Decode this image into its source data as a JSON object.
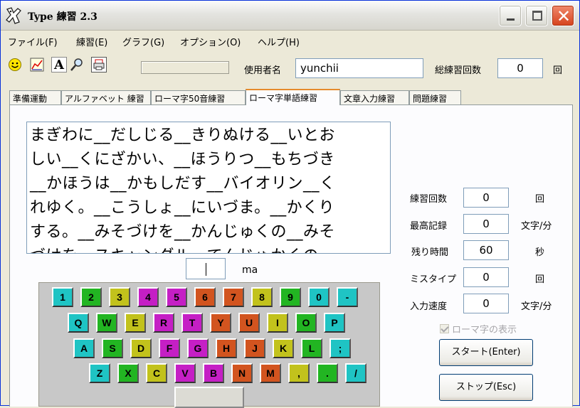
{
  "window": {
    "title": "Type 練習 2.3",
    "close_glyph": "✕"
  },
  "menu": [
    "ファイル(F)",
    "練習(E)",
    "グラフ(G)",
    "オプション(O)",
    "ヘルプ(H)"
  ],
  "toolbar": {
    "icons": [
      "smiley-icon",
      "graph-icon",
      "font-icon",
      "search-icon",
      "printer-icon"
    ],
    "font_icon_glyph": "A",
    "user_label": "使用者名",
    "user_value": "yunchii",
    "total_label": "総練習回数",
    "total_value": "0",
    "total_unit": "回"
  },
  "tabs": [
    "準備運動",
    "アルファベット 練習",
    "ローマ字50音練習",
    "ローマ字単語練習",
    "文章入力練習",
    "問題練習"
  ],
  "active_tab": "ローマ字単語練習",
  "practice_text": [
    "まぎわに__だしじる__きりぬける__いとお",
    "しい__くにざかい、__ほうりつ__もちづき",
    "__かほうは__かもしだす__バイオリン__く",
    "れゆく。__こうしょ__にいづま。__かくり",
    "する。__みそづけを__かんじゅくの__みそ",
    "づけを__スキャンダル__てんじゅかくの"
  ],
  "input": {
    "value": "",
    "romaji_hint": "ma"
  },
  "keyboard": {
    "rows": [
      [
        {
          "label": "1",
          "color": "#1fc4c4"
        },
        {
          "label": "2",
          "color": "#22b522"
        },
        {
          "label": "3",
          "color": "#c2c21c"
        },
        {
          "label": "4",
          "color": "#c51fc5"
        },
        {
          "label": "5",
          "color": "#c51fc5"
        },
        {
          "label": "6",
          "color": "#d2541f"
        },
        {
          "label": "7",
          "color": "#d2541f"
        },
        {
          "label": "8",
          "color": "#c2c21c"
        },
        {
          "label": "9",
          "color": "#22b522"
        },
        {
          "label": "0",
          "color": "#1fc4c4"
        },
        {
          "label": "-",
          "color": "#1fc4c4"
        }
      ],
      [
        {
          "label": "Q",
          "color": "#1fc4c4"
        },
        {
          "label": "W",
          "color": "#22b522"
        },
        {
          "label": "E",
          "color": "#c2c21c"
        },
        {
          "label": "R",
          "color": "#c51fc5"
        },
        {
          "label": "T",
          "color": "#c51fc5"
        },
        {
          "label": "Y",
          "color": "#d2541f"
        },
        {
          "label": "U",
          "color": "#d2541f"
        },
        {
          "label": "I",
          "color": "#c2c21c"
        },
        {
          "label": "O",
          "color": "#22b522"
        },
        {
          "label": "P",
          "color": "#1fc4c4"
        }
      ],
      [
        {
          "label": "A",
          "color": "#1fc4c4"
        },
        {
          "label": "S",
          "color": "#22b522"
        },
        {
          "label": "D",
          "color": "#c2c21c"
        },
        {
          "label": "F",
          "color": "#c51fc5"
        },
        {
          "label": "G",
          "color": "#c51fc5"
        },
        {
          "label": "H",
          "color": "#d2541f"
        },
        {
          "label": "J",
          "color": "#d2541f"
        },
        {
          "label": "K",
          "color": "#c2c21c"
        },
        {
          "label": "L",
          "color": "#22b522"
        },
        {
          "label": ";",
          "color": "#1fc4c4"
        }
      ],
      [
        {
          "label": "Z",
          "color": "#1fc4c4"
        },
        {
          "label": "X",
          "color": "#22b522"
        },
        {
          "label": "C",
          "color": "#c2c21c"
        },
        {
          "label": "V",
          "color": "#c51fc5"
        },
        {
          "label": "B",
          "color": "#c51fc5"
        },
        {
          "label": "N",
          "color": "#d2541f"
        },
        {
          "label": "M",
          "color": "#d2541f"
        },
        {
          "label": ",",
          "color": "#c2c21c"
        },
        {
          "label": ".",
          "color": "#22b522"
        },
        {
          "label": "/",
          "color": "#1fc4c4"
        }
      ]
    ]
  },
  "stats": [
    {
      "label": "練習回数",
      "value": "0",
      "unit": "回"
    },
    {
      "label": "最高記録",
      "value": "0",
      "unit": "文字/分"
    },
    {
      "label": "残り時間",
      "value": "60",
      "unit": "秒"
    },
    {
      "label": "ミスタイプ",
      "value": "0",
      "unit": "回"
    },
    {
      "label": "入力速度",
      "value": "0",
      "unit": "文字/分"
    }
  ],
  "romaji_display": {
    "label": "ローマ字の表示",
    "checked": true,
    "enabled": false
  },
  "buttons": {
    "start": "スタート(Enter)",
    "stop": "ストップ(Esc)"
  }
}
